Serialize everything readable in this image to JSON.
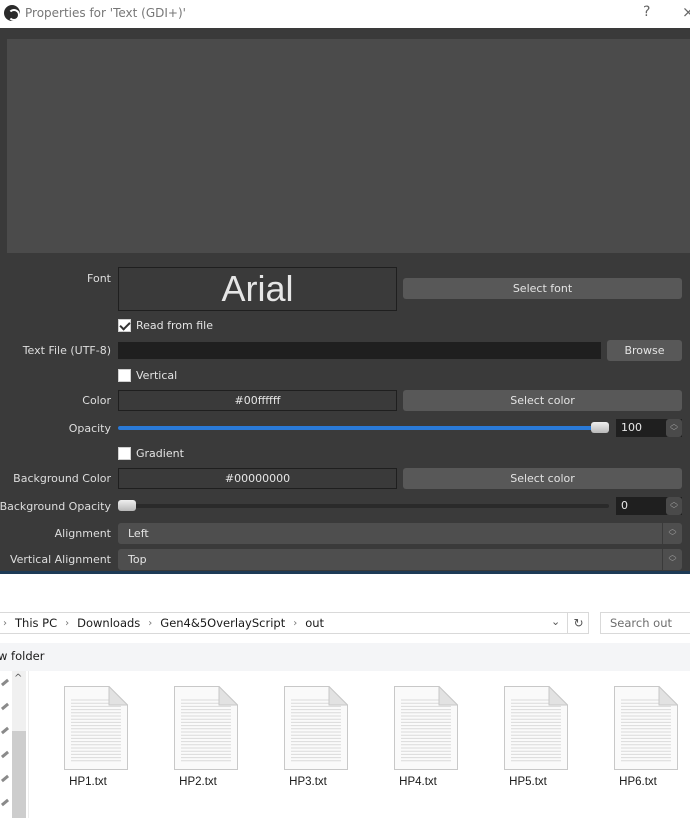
{
  "window": {
    "title": "Properties for 'Text (GDI+)'",
    "help_label": "?",
    "close_label": "×"
  },
  "properties": {
    "font": {
      "label": "Font",
      "value": "Arial",
      "button": "Select font"
    },
    "read_from_file": {
      "label": "Read from file",
      "checked": true
    },
    "text_file": {
      "label": "Text File (UTF-8)",
      "value": "",
      "button": "Browse"
    },
    "vertical": {
      "label": "Vertical",
      "checked": false
    },
    "color": {
      "label": "Color",
      "value": "#00ffffff",
      "button": "Select color"
    },
    "opacity": {
      "label": "Opacity",
      "value": "100",
      "percent": 100
    },
    "gradient": {
      "label": "Gradient",
      "checked": false
    },
    "background_color": {
      "label": "Background Color",
      "value": "#00000000",
      "button": "Select color"
    },
    "background_opacity": {
      "label": "Background Opacity",
      "value": "0",
      "percent": 0
    },
    "alignment": {
      "label": "Alignment",
      "value": "Left"
    },
    "vertical_alignment": {
      "label": "Vertical Alignment",
      "value": "Top"
    }
  },
  "explorer": {
    "breadcrumb": [
      "This PC",
      "Downloads",
      "Gen4&5OverlayScript",
      "out"
    ],
    "search_placeholder": "Search out",
    "command": "w folder",
    "files": [
      "HP1.txt",
      "HP2.txt",
      "HP3.txt",
      "HP4.txt",
      "HP5.txt",
      "HP6.txt"
    ]
  },
  "colors": {
    "accent": "#2a7ad8",
    "dialog_bg": "#3a3a3a",
    "preview_bg": "#4b4b4b"
  }
}
